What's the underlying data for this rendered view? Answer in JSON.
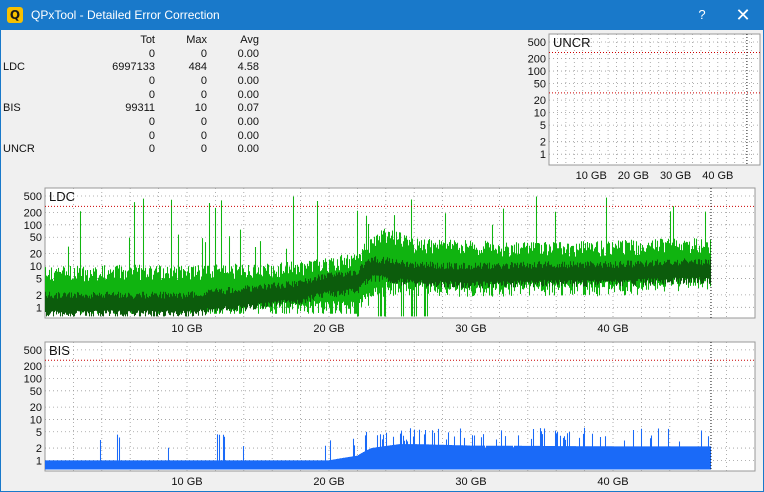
{
  "window": {
    "icon_letter": "Q",
    "title": "QPxTool - Detailed Error Correction",
    "help_glyph": "?",
    "close_glyph": "✕"
  },
  "stats": {
    "headers": [
      "",
      "Tot",
      "Max",
      "Avg"
    ],
    "rows": [
      [
        "",
        "0",
        "0",
        "0.00"
      ],
      [
        "LDC",
        "6997133",
        "484",
        "4.58"
      ],
      [
        "",
        "0",
        "0",
        "0.00"
      ],
      [
        "",
        "0",
        "0",
        "0.00"
      ],
      [
        "BIS",
        "99311",
        "10",
        "0.07"
      ],
      [
        "",
        "0",
        "0",
        "0.00"
      ],
      [
        "",
        "0",
        "0",
        "0.00"
      ],
      [
        "UNCR",
        "0",
        "0",
        "0.00"
      ]
    ]
  },
  "colors": {
    "ldc_light": "#10b410",
    "ldc_dark": "#0c5c0c",
    "bis": "#1a6af8",
    "threshold": "#cc0000",
    "grid": "#9a9a9a"
  },
  "chart_data": [
    {
      "type": "area",
      "title": "UNCR",
      "y_scale": "log",
      "y_ticks": [
        "1",
        "2",
        "5",
        "10",
        "20",
        "50",
        "100",
        "200",
        "500"
      ],
      "x_ticks": [
        "10 GB",
        "20 GB",
        "30 GB",
        "40 GB"
      ],
      "x_tick_values": [
        10,
        20,
        30,
        40
      ],
      "xlim": [
        0,
        50
      ],
      "end_marker_x": 46.9,
      "threshold_y": [
        280,
        30
      ],
      "series": [
        {
          "values": []
        }
      ],
      "grid": true
    },
    {
      "type": "area",
      "title": "LDC",
      "y_scale": "log",
      "y_ticks": [
        "1",
        "2",
        "5",
        "10",
        "20",
        "50",
        "100",
        "200",
        "500"
      ],
      "x_ticks": [
        "10 GB",
        "20 GB",
        "30 GB",
        "40 GB"
      ],
      "x_tick_values": [
        10,
        20,
        30,
        40
      ],
      "xlim": [
        0,
        50
      ],
      "end_marker_x": 46.9,
      "threshold_y": [
        280
      ],
      "grid": true,
      "profile": {
        "x": [
          0,
          5,
          10,
          15,
          18,
          20,
          22,
          23,
          24,
          25,
          26,
          30,
          35,
          40,
          45,
          46.9
        ],
        "peak": [
          8,
          9,
          9,
          10,
          11,
          14,
          18,
          40,
          70,
          55,
          40,
          35,
          32,
          35,
          40,
          40
        ],
        "base": [
          1,
          1,
          1,
          1,
          1,
          1,
          1,
          2,
          3,
          3,
          3,
          3,
          3,
          3,
          4,
          4
        ],
        "dark_top": [
          2,
          2,
          2,
          3,
          4,
          6,
          7,
          15,
          14,
          12,
          11,
          10,
          11,
          11,
          13,
          13
        ],
        "max": 484
      }
    },
    {
      "type": "area",
      "title": "BIS",
      "y_scale": "log",
      "y_ticks": [
        "1",
        "2",
        "5",
        "10",
        "20",
        "50",
        "100",
        "200",
        "500"
      ],
      "x_ticks": [
        "10 GB",
        "20 GB",
        "30 GB",
        "40 GB"
      ],
      "x_tick_values": [
        10,
        20,
        30,
        40
      ],
      "xlim": [
        0,
        50
      ],
      "end_marker_x": 46.9,
      "threshold_y": [
        280
      ],
      "grid": true,
      "profile": {
        "x": [
          0,
          10,
          20,
          22,
          23,
          25,
          26,
          30,
          40,
          46.9
        ],
        "fill": [
          1,
          1,
          1,
          1.3,
          2,
          2.5,
          2.5,
          2.3,
          2.2,
          2.2
        ],
        "max": 10
      }
    }
  ]
}
